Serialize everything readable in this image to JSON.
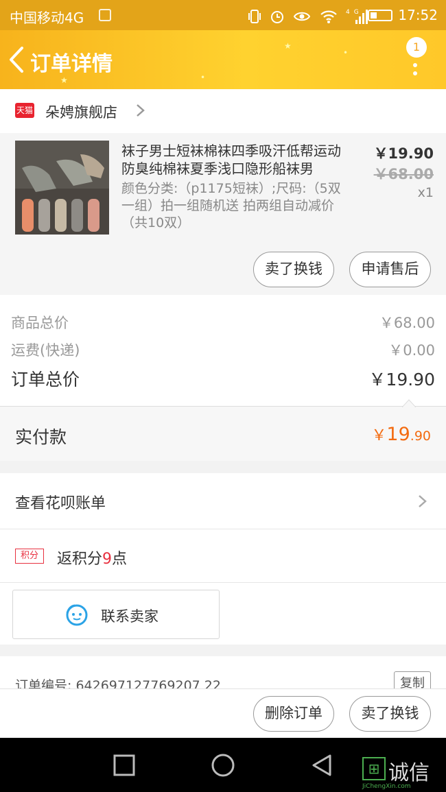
{
  "status_bar": {
    "carrier": "中国移动4G",
    "signal_label": "4G",
    "time": "17:52"
  },
  "header": {
    "title": "订单详情",
    "badge_count": "1"
  },
  "shop": {
    "platform_tag": "天猫",
    "name": "朵娉旗舰店"
  },
  "product": {
    "title": "袜子男士短袜棉袜四季吸汗低帮运动防臭纯棉袜夏季浅口隐形船袜男",
    "spec": "颜色分类:（p1175短袜）;尺码:（5双一组）拍一组随机送 拍两组自动减价（共10双）",
    "price": "￥19.90",
    "original_price": "￥68.00",
    "quantity": "x1",
    "actions": [
      "卖了换钱",
      "申请售后"
    ]
  },
  "summary": {
    "goods_total_label": "商品总价",
    "goods_total_value": "￥68.00",
    "shipping_label": "运费(快递)",
    "shipping_value": "￥0.00",
    "order_total_label": "订单总价",
    "order_total_value": "￥19.90"
  },
  "paid": {
    "label": "实付款",
    "currency": "￥",
    "amount_int": "19",
    "amount_dec": ".90"
  },
  "huabei": {
    "label": "查看花呗账单"
  },
  "points": {
    "tag": "积分",
    "prefix": "返积分",
    "count": "9",
    "suffix": "点"
  },
  "contact": {
    "label": "联系卖家"
  },
  "order": {
    "number_text": "订单编号: 642697127769207 22",
    "copy_label": "复制"
  },
  "bottom_actions": {
    "delete": "删除订单",
    "resell": "卖了换钱"
  },
  "watermark": {
    "text": "诚信",
    "sub": "JiChengXin.com"
  },
  "colors": {
    "header": "#ffc829",
    "accent_price": "#f36b10",
    "points": "#e8303f",
    "tmall": "#e8232f"
  }
}
